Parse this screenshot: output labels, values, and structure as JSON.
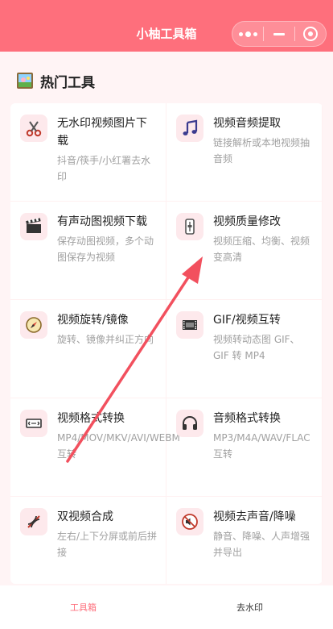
{
  "app": {
    "title": "小柚工具箱"
  },
  "section": {
    "title": "热门工具",
    "icon": "picture-icon"
  },
  "tools": [
    {
      "name": "无水印视频图片下载",
      "desc": "抖音/筷手/小红署去水印",
      "icon": "scissors-icon"
    },
    {
      "name": "视频音频提取",
      "desc": "链接解析或本地视频抽音频",
      "icon": "music-note-icon"
    },
    {
      "name": "有声动图视频下载",
      "desc": "保存动图视频，多个动图保存为视频",
      "icon": "clapperboard-icon"
    },
    {
      "name": "视频质量修改",
      "desc": "视频压缩、均衡、视频变高清",
      "icon": "phone-slider-icon"
    },
    {
      "name": "视频旋转/镜像",
      "desc": "旋转、镜像并纠正方向",
      "icon": "compass-icon"
    },
    {
      "name": "GIF/视频互转",
      "desc": "视频转动态图 GIF、GIF 转 MP4",
      "icon": "film-strip-icon"
    },
    {
      "name": "视频格式转换",
      "desc": "MP4/MOV/MKV/AVI/WEBM 互转",
      "icon": "video-format-icon"
    },
    {
      "name": "音频格式转换",
      "desc": "MP3/M4A/WAV/FLAC 互转",
      "icon": "headphones-icon"
    },
    {
      "name": "双视频合成",
      "desc": "左右/上下分屏或前后拼接",
      "icon": "dna-icon"
    },
    {
      "name": "视频去声音/降噪",
      "desc": "静音、降噪、人声增强并导出",
      "icon": "mute-icon"
    }
  ],
  "tabbar": {
    "tab1": "工具箱",
    "tab2": "去水印"
  },
  "colors": {
    "primary": "#fe6f7c",
    "background": "#fff4f5",
    "arrow": "#f2505e"
  }
}
